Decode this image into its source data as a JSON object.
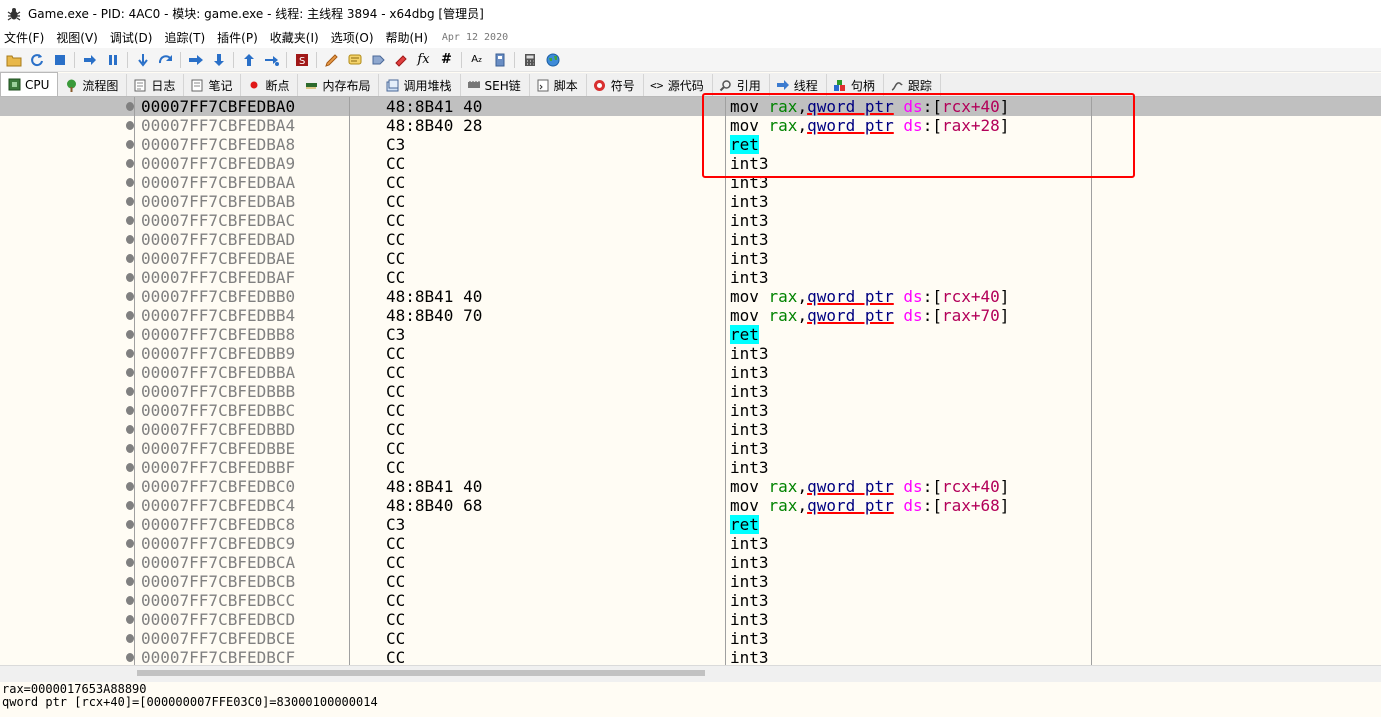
{
  "window": {
    "title": "Game.exe - PID: 4AC0 - 模块: game.exe - 线程: 主线程 3894 - x64dbg [管理员]"
  },
  "menu": {
    "items": [
      "文件(F)",
      "视图(V)",
      "调试(D)",
      "追踪(T)",
      "插件(P)",
      "收藏夹(I)",
      "选项(O)",
      "帮助(H)"
    ],
    "date": "Apr 12 2020"
  },
  "toolbar": {
    "icons": [
      "open-icon",
      "restart-icon",
      "stop-icon",
      "run-icon",
      "pause-icon",
      "step-into-icon",
      "step-over-icon",
      "trace-into-icon",
      "trace-over-icon",
      "execute-till-return-icon",
      "run-to-user-code-icon",
      "scylla-icon",
      "patch-icon",
      "comment-icon",
      "label-icon",
      "bookmark-icon",
      "function-icon",
      "hash-icon",
      "strings-icon",
      "calculator-icon",
      "cheat-icon",
      "globe-icon"
    ]
  },
  "tabs": [
    "CPU",
    "流程图",
    "日志",
    "笔记",
    "断点",
    "内存布局",
    "调用堆栈",
    "SEH链",
    "脚本",
    "符号",
    "源代码",
    "引用",
    "线程",
    "句柄",
    "跟踪"
  ],
  "rows": [
    {
      "addr": "00007FF7CBFEDBA0",
      "bytes": "48:8B41 40",
      "kind": "mov",
      "reg": "rax",
      "size": "qword ptr",
      "seg": "ds",
      "mem": "rcx+40"
    },
    {
      "addr": "00007FF7CBFEDBA4",
      "bytes": "48:8B40 28",
      "kind": "mov",
      "reg": "rax",
      "size": "qword ptr",
      "seg": "ds",
      "mem": "rax+28"
    },
    {
      "addr": "00007FF7CBFEDBA8",
      "bytes": "C3",
      "kind": "ret"
    },
    {
      "addr": "00007FF7CBFEDBA9",
      "bytes": "CC",
      "kind": "int3"
    },
    {
      "addr": "00007FF7CBFEDBAA",
      "bytes": "CC",
      "kind": "int3"
    },
    {
      "addr": "00007FF7CBFEDBAB",
      "bytes": "CC",
      "kind": "int3"
    },
    {
      "addr": "00007FF7CBFEDBAC",
      "bytes": "CC",
      "kind": "int3"
    },
    {
      "addr": "00007FF7CBFEDBAD",
      "bytes": "CC",
      "kind": "int3"
    },
    {
      "addr": "00007FF7CBFEDBAE",
      "bytes": "CC",
      "kind": "int3"
    },
    {
      "addr": "00007FF7CBFEDBAF",
      "bytes": "CC",
      "kind": "int3"
    },
    {
      "addr": "00007FF7CBFEDBB0",
      "bytes": "48:8B41 40",
      "kind": "mov",
      "reg": "rax",
      "size": "qword ptr",
      "seg": "ds",
      "mem": "rcx+40"
    },
    {
      "addr": "00007FF7CBFEDBB4",
      "bytes": "48:8B40 70",
      "kind": "mov",
      "reg": "rax",
      "size": "qword ptr",
      "seg": "ds",
      "mem": "rax+70"
    },
    {
      "addr": "00007FF7CBFEDBB8",
      "bytes": "C3",
      "kind": "ret"
    },
    {
      "addr": "00007FF7CBFEDBB9",
      "bytes": "CC",
      "kind": "int3"
    },
    {
      "addr": "00007FF7CBFEDBBA",
      "bytes": "CC",
      "kind": "int3"
    },
    {
      "addr": "00007FF7CBFEDBBB",
      "bytes": "CC",
      "kind": "int3"
    },
    {
      "addr": "00007FF7CBFEDBBC",
      "bytes": "CC",
      "kind": "int3"
    },
    {
      "addr": "00007FF7CBFEDBBD",
      "bytes": "CC",
      "kind": "int3"
    },
    {
      "addr": "00007FF7CBFEDBBE",
      "bytes": "CC",
      "kind": "int3"
    },
    {
      "addr": "00007FF7CBFEDBBF",
      "bytes": "CC",
      "kind": "int3"
    },
    {
      "addr": "00007FF7CBFEDBC0",
      "bytes": "48:8B41 40",
      "kind": "mov",
      "reg": "rax",
      "size": "qword ptr",
      "seg": "ds",
      "mem": "rcx+40"
    },
    {
      "addr": "00007FF7CBFEDBC4",
      "bytes": "48:8B40 68",
      "kind": "mov",
      "reg": "rax",
      "size": "qword ptr",
      "seg": "ds",
      "mem": "rax+68"
    },
    {
      "addr": "00007FF7CBFEDBC8",
      "bytes": "C3",
      "kind": "ret"
    },
    {
      "addr": "00007FF7CBFEDBC9",
      "bytes": "CC",
      "kind": "int3"
    },
    {
      "addr": "00007FF7CBFEDBCA",
      "bytes": "CC",
      "kind": "int3"
    },
    {
      "addr": "00007FF7CBFEDBCB",
      "bytes": "CC",
      "kind": "int3"
    },
    {
      "addr": "00007FF7CBFEDBCC",
      "bytes": "CC",
      "kind": "int3"
    },
    {
      "addr": "00007FF7CBFEDBCD",
      "bytes": "CC",
      "kind": "int3"
    },
    {
      "addr": "00007FF7CBFEDBCE",
      "bytes": "CC",
      "kind": "int3"
    },
    {
      "addr": "00007FF7CBFEDBCF",
      "bytes": "CC",
      "kind": "int3"
    }
  ],
  "info": {
    "line1": "rax=0000017653A88890",
    "line2": "qword ptr [rcx+40]=[000000007FFE03C0]=83000100000014"
  },
  "colors": {
    "selected_row": "#c0c0c0",
    "ret_highlight": "#00ffff",
    "register": "#008300",
    "segment": "#ff00ff",
    "memory": "#b30059",
    "annotation_box": "#ff0000"
  }
}
